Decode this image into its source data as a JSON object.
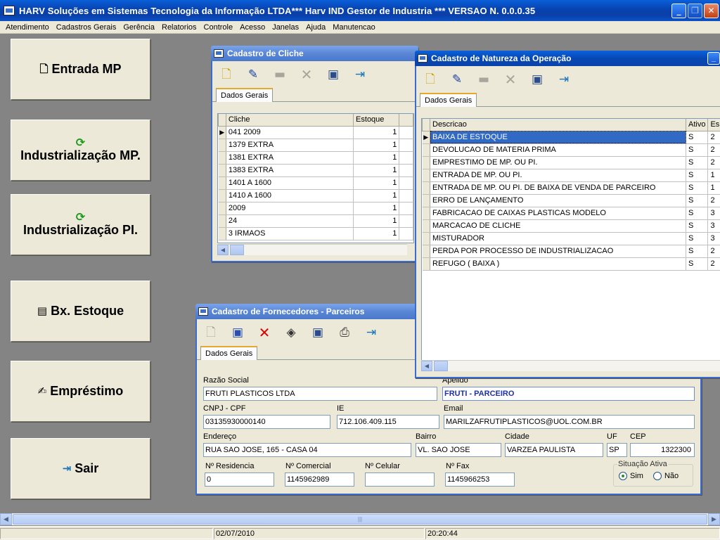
{
  "app": {
    "title": "HARV Soluções em Sistemas Tecnologia da Informação LTDA*** Harv IND Gestor de Industria *** VERSAO N.  0.0.0.35",
    "caption_buttons": {
      "minimize": "_",
      "restore": "❐",
      "close": "✕"
    }
  },
  "menu": [
    "Atendimento",
    "Cadastros Gerais",
    "Gerência",
    "Relatorios",
    "Controle",
    "Acesso",
    "Janelas",
    "Ajuda",
    "Manutencao"
  ],
  "shortcuts": [
    {
      "label": "Entrada MP",
      "icon": "new-document-icon"
    },
    {
      "label": "Industrialização MP.",
      "icon": "refresh-icon"
    },
    {
      "label": "Industrialização PI.",
      "icon": "refresh-icon"
    },
    {
      "label": "Bx. Estoque",
      "icon": "documents-icon"
    },
    {
      "label": "Empréstimo",
      "icon": "hand-money-icon"
    },
    {
      "label": "Sair",
      "icon": "exit-door-icon"
    }
  ],
  "cliche_window": {
    "title": "Cadastro de Cliche",
    "tab": "Dados Gerais",
    "columns": [
      "Cliche",
      "Estoque"
    ],
    "rows": [
      {
        "cliche": "041 2009",
        "estoque": "1"
      },
      {
        "cliche": "1379 EXTRA",
        "estoque": "1"
      },
      {
        "cliche": "1381 EXTRA",
        "estoque": "1"
      },
      {
        "cliche": "1383 EXTRA",
        "estoque": "1"
      },
      {
        "cliche": "1401 A 1600",
        "estoque": "1"
      },
      {
        "cliche": "1410 A 1600",
        "estoque": "1"
      },
      {
        "cliche": "2009",
        "estoque": "1"
      },
      {
        "cliche": "24",
        "estoque": "1"
      },
      {
        "cliche": "3 IRMAOS",
        "estoque": "1"
      }
    ]
  },
  "natureza_window": {
    "title": "Cadastro de Natureza da Operação",
    "tab": "Dados Gerais",
    "columns": [
      "Descricao",
      "Ativo",
      "Es"
    ],
    "rows": [
      {
        "descricao": "BAIXA DE ESTOQUE",
        "ativo": "S",
        "es": "2"
      },
      {
        "descricao": "DEVOLUCAO DE MATERIA PRIMA",
        "ativo": "S",
        "es": "2"
      },
      {
        "descricao": "EMPRESTIMO DE MP. OU PI.",
        "ativo": "S",
        "es": "2"
      },
      {
        "descricao": "ENTRADA DE MP. OU PI.",
        "ativo": "S",
        "es": "1"
      },
      {
        "descricao": "ENTRADA DE MP. OU PI. DE BAIXA DE VENDA DE PARCEIRO",
        "ativo": "S",
        "es": "1"
      },
      {
        "descricao": "ERRO DE LANÇAMENTO",
        "ativo": "S",
        "es": "2"
      },
      {
        "descricao": "FABRICACAO DE CAIXAS PLASTICAS MODELO",
        "ativo": "S",
        "es": "3"
      },
      {
        "descricao": "MARCACAO DE CLICHE",
        "ativo": "S",
        "es": "3"
      },
      {
        "descricao": "MISTURADOR",
        "ativo": "S",
        "es": "3"
      },
      {
        "descricao": "PERDA POR PROCESSO DE INDUSTRIALIZACAO",
        "ativo": "S",
        "es": "2"
      },
      {
        "descricao": "REFUGO ( BAIXA )",
        "ativo": "S",
        "es": "2"
      }
    ]
  },
  "fornecedores_window": {
    "title": "Cadastro de Fornecedores - Parceiros",
    "tab": "Dados Gerais",
    "labels": {
      "razao_social": "Razão Social",
      "apelido": "Apelido",
      "cnpj": "CNPJ - CPF",
      "ie": "IE",
      "email": "Email",
      "endereco": "Endereço",
      "bairro": "Bairro",
      "cidade": "Cidade",
      "uf": "UF",
      "cep": "CEP",
      "n_residencia": "Nº Residencia",
      "n_comercial": "Nº Comercial",
      "n_celular": "Nº Celular",
      "n_fax": "Nº Fax",
      "situacao": "Situação Ativa",
      "sim": "Sim",
      "nao": "Não"
    },
    "values": {
      "razao_social": "FRUTI PLASTICOS LTDA",
      "apelido": "FRUTI - PARCEIRO",
      "cnpj": "03135930000140",
      "ie": "712.106.409.115",
      "email": "MARILZAFRUTIPLASTICOS@UOL.COM.BR",
      "endereco": "RUA SAO JOSE, 165 - CASA 04",
      "bairro": "VL. SAO JOSE",
      "cidade": "VARZEA PAULISTA",
      "uf": "SP",
      "cep": "1322300",
      "n_residencia": "0",
      "n_comercial": "1145962989",
      "n_celular": "",
      "n_fax": "1145966253",
      "situacao": "Sim"
    }
  },
  "status": {
    "date": "02/07/2010",
    "time": "20:20:44"
  },
  "colors": {
    "selection": "#316ac5",
    "titlebar": "#0a4ec2",
    "face": "#ece9d8",
    "mdi_bg": "#848484"
  }
}
